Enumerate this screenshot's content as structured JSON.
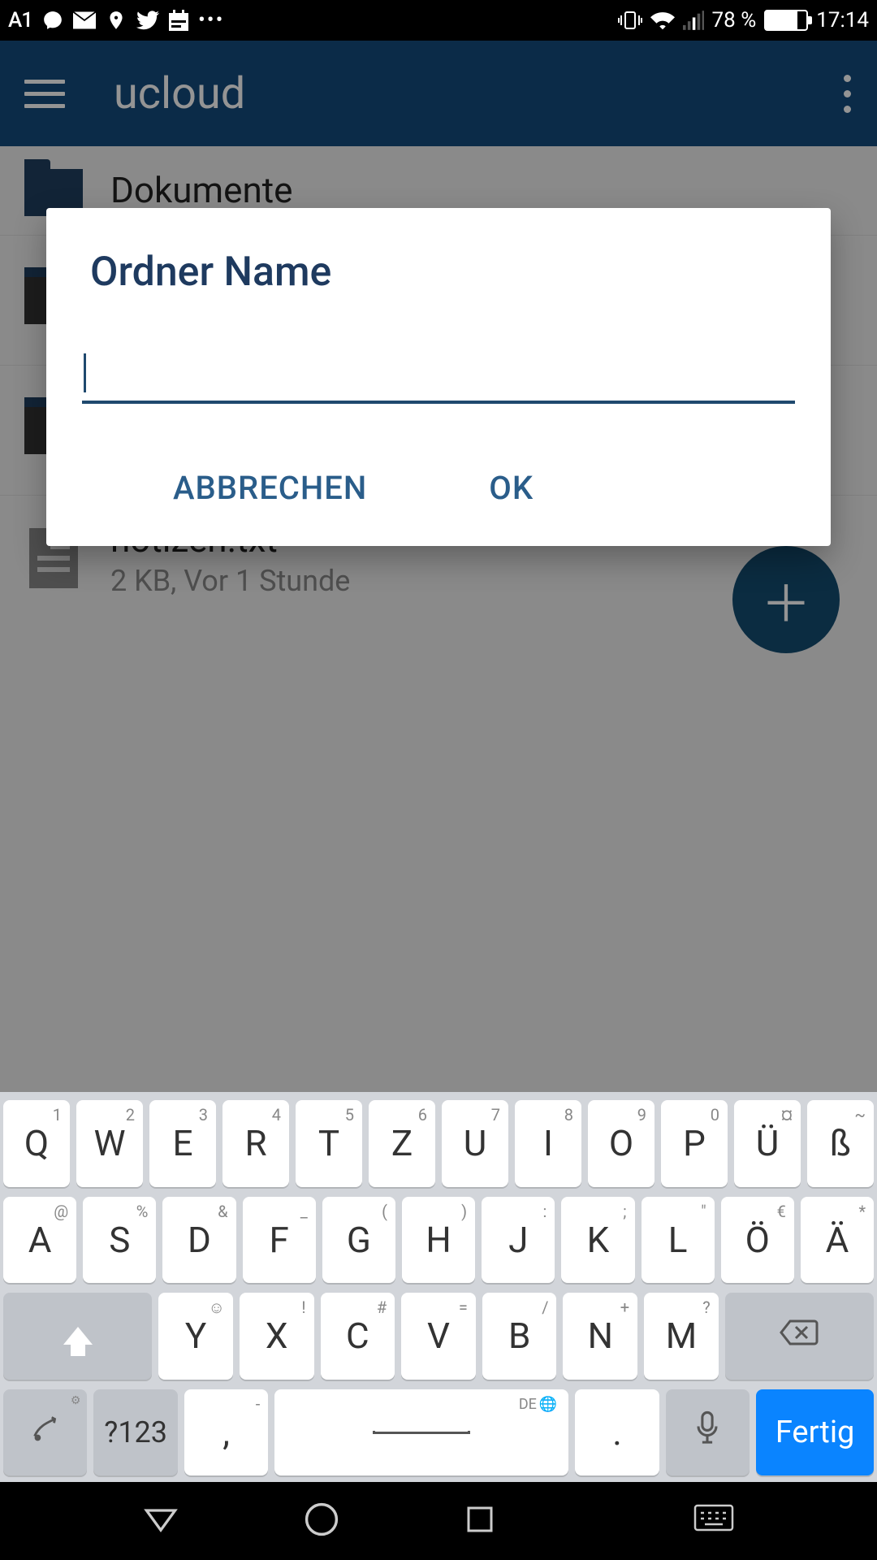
{
  "statusbar": {
    "carrier": "A1",
    "battery_pct": "78 %",
    "time": "17:14"
  },
  "appbar": {
    "title": "ucloud"
  },
  "list": [
    {
      "primary": "Dokumente",
      "secondary": ""
    },
    {
      "primary": "",
      "secondary": ""
    },
    {
      "primary": "",
      "secondary": ""
    },
    {
      "primary": "notizen.txt",
      "secondary": "2 KB, Vor 1 Stunde"
    }
  ],
  "dialog": {
    "title": "Ordner Name",
    "input_value": "",
    "cancel": "ABBRECHEN",
    "ok": "OK"
  },
  "keyboard": {
    "row1": [
      {
        "m": "Q",
        "s": "1"
      },
      {
        "m": "W",
        "s": "2"
      },
      {
        "m": "E",
        "s": "3"
      },
      {
        "m": "R",
        "s": "4"
      },
      {
        "m": "T",
        "s": "5"
      },
      {
        "m": "Z",
        "s": "6"
      },
      {
        "m": "U",
        "s": "7"
      },
      {
        "m": "I",
        "s": "8"
      },
      {
        "m": "O",
        "s": "9"
      },
      {
        "m": "P",
        "s": "0"
      },
      {
        "m": "Ü",
        "s": "¤"
      },
      {
        "m": "ß",
        "s": "~"
      }
    ],
    "row2": [
      {
        "m": "A",
        "s": "@"
      },
      {
        "m": "S",
        "s": "%"
      },
      {
        "m": "D",
        "s": "&"
      },
      {
        "m": "F",
        "s": "_"
      },
      {
        "m": "G",
        "s": "("
      },
      {
        "m": "H",
        "s": ")"
      },
      {
        "m": "J",
        "s": ":"
      },
      {
        "m": "K",
        "s": ";"
      },
      {
        "m": "L",
        "s": "\""
      },
      {
        "m": "Ö",
        "s": "€"
      },
      {
        "m": "Ä",
        "s": "*"
      }
    ],
    "row3": [
      {
        "m": "Y",
        "s": "☺"
      },
      {
        "m": "X",
        "s": "!"
      },
      {
        "m": "C",
        "s": "#"
      },
      {
        "m": "V",
        "s": "="
      },
      {
        "m": "B",
        "s": "/"
      },
      {
        "m": "N",
        "s": "+"
      },
      {
        "m": "M",
        "s": "?"
      }
    ],
    "symbols_key": "?123",
    "comma": ",",
    "period": ".",
    "space_lang": "DE",
    "enter": "Fertig"
  }
}
